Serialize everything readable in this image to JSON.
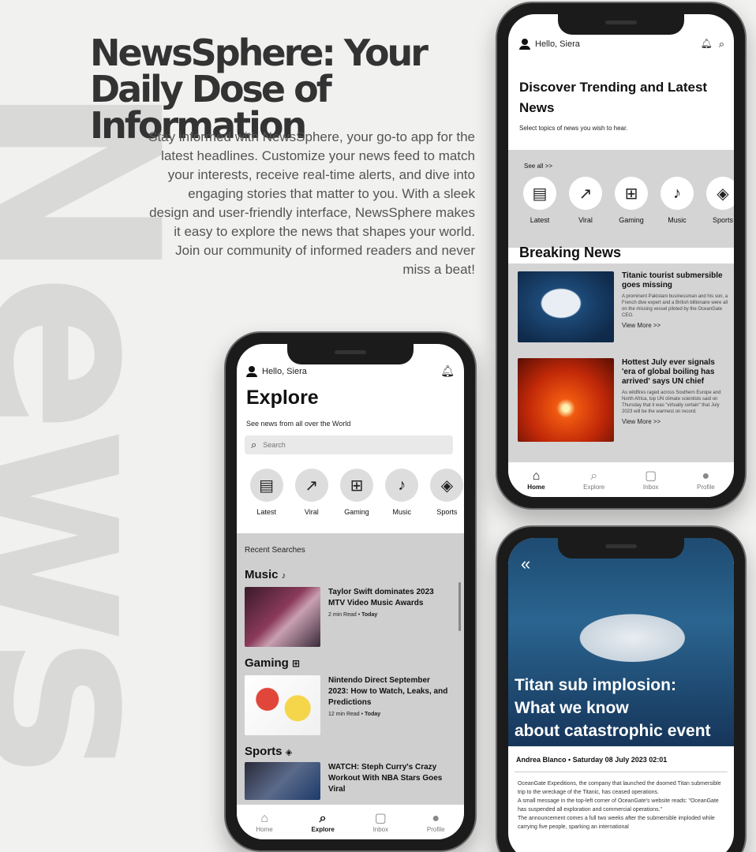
{
  "background_word": "News",
  "hero": {
    "title": "NewsSphere: Your Daily Dose of Information",
    "description": "Stay informed with NewsSphere, your go-to app for the latest headlines. Customize your news feed to match your interests, receive real-time alerts, and dive into engaging stories that matter to you. With a sleek design and user-friendly interface, NewsSphere makes it easy to explore the news that shapes your world. Join our community of informed readers and never miss a beat!"
  },
  "colors": {
    "background": "#f1f1f0",
    "panel": "#cfcfcf",
    "text": "#222222"
  },
  "explore_phone": {
    "greeting": "Hello, Siera",
    "title": "Explore",
    "subtitle": "See news from all over the World",
    "search_placeholder": "Search",
    "categories": [
      {
        "label": "Latest",
        "icon": "newspaper-icon"
      },
      {
        "label": "Viral",
        "icon": "trending-up-icon"
      },
      {
        "label": "Gaming",
        "icon": "gamepad-icon"
      },
      {
        "label": "Music",
        "icon": "microphone-icon"
      },
      {
        "label": "Sports",
        "icon": "football-icon"
      }
    ],
    "recent_searches_label": "Recent Searches",
    "sections": [
      {
        "heading": "Music",
        "icon": "microphone-icon",
        "title": "Taylor Swift dominates 2023 MTV Video Music Awards",
        "read_time": "2 min Read",
        "when": "Today"
      },
      {
        "heading": "Gaming",
        "icon": "gamepad-icon",
        "title": "Nintendo Direct September 2023: How to Watch, Leaks, and Predictions",
        "read_time": "12 min Read",
        "when": "Today"
      },
      {
        "heading": "Sports",
        "icon": "football-icon",
        "title": "WATCH: Steph Curry's Crazy Workout With NBA Stars Goes Viral",
        "read_time": "",
        "when": ""
      }
    ],
    "nav": [
      "Home",
      "Explore",
      "Inbox",
      "Profile"
    ]
  },
  "home_phone": {
    "greeting": "Hello, Siera",
    "title": "Discover Trending and Latest News",
    "subtitle": "Select topics of news you wish to hear.",
    "see_all": "See all >>",
    "categories": [
      "Latest",
      "Viral",
      "Gaming",
      "Music",
      "Sports"
    ],
    "breaking_label": "Breaking News",
    "articles": [
      {
        "title": "Titanic tourist submersible goes missing",
        "body": "A prominent Pakistani businessman and his son, a French dive expert and a British billionaire were all on the missing vessel piloted by the OceanGate CEO.",
        "more": "View More >>"
      },
      {
        "title": "Hottest July ever signals 'era of global boiling has arrived' says UN chief",
        "body": "As wildfires raged across Southern Europe and North Africa, top UN climate scientists said on Thursday that it was \"virtually certain\" that July 2023 will be the warmest on record.",
        "more": "View More >>"
      }
    ],
    "nav": [
      "Home",
      "Explore",
      "Inbox",
      "Profile"
    ]
  },
  "article_phone": {
    "back": "«",
    "headline_line1": "Titan sub implosion:",
    "headline_line2": "What we know",
    "headline_line3": "about catastrophic event",
    "byline": "Andrea Blanco • Saturday 08 July 2023 02:01",
    "paragraph1": "OceanGate Expeditions, the company that launched the doomed Titan submersible trip to the wreckage of the Titanic, has ceased operations.",
    "paragraph2": "A small message in the top-left corner of OceanGate's website reads: \"OceanGate has suspended all exploration and commercial operations.\"",
    "paragraph3": "The announcement comes a full two weeks after the submersible imploded while carrying five people, sparking an international"
  }
}
